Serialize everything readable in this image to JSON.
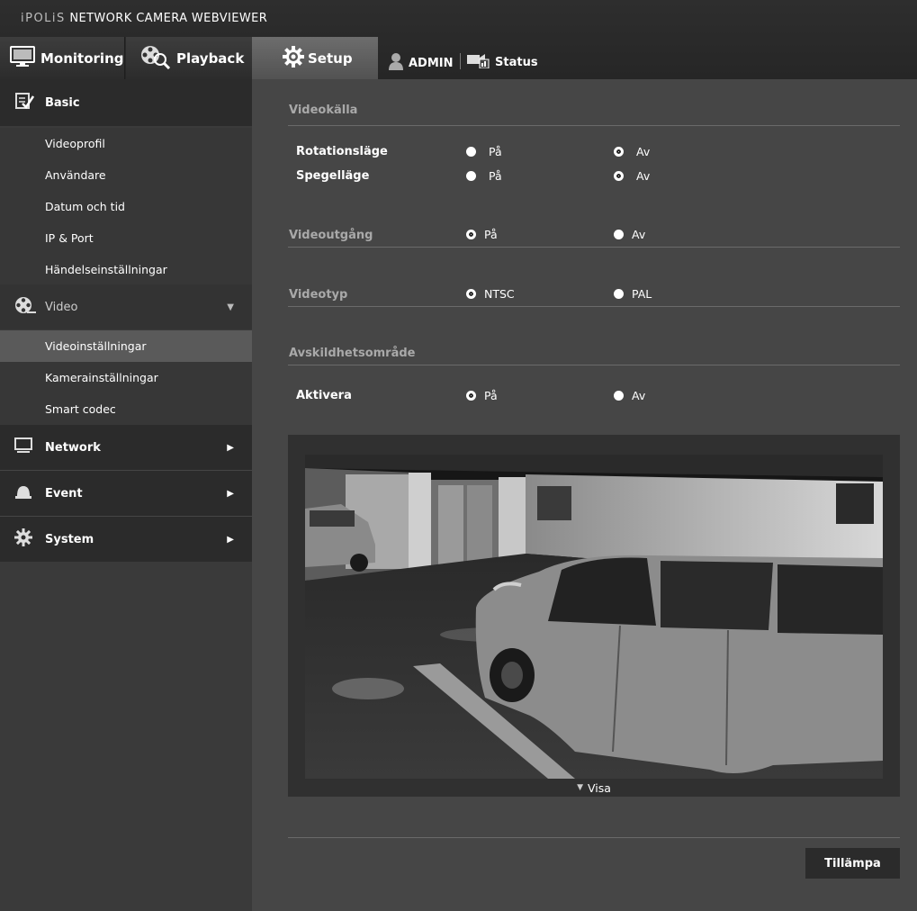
{
  "app": {
    "brand_prefix": "iPOLiS",
    "brand_title": "NETWORK CAMERA WEBVIEWER"
  },
  "nav": {
    "monitoring": "Monitoring",
    "playback": "Playback",
    "setup": "Setup",
    "admin": "ADMIN",
    "status": "Status"
  },
  "sidebar": {
    "basic": {
      "label": "Basic",
      "items": [
        "Videoprofil",
        "Användare",
        "Datum och tid",
        "IP & Port",
        "Händelseinställningar"
      ]
    },
    "video": {
      "label": "Video",
      "items": [
        "Videoinställningar",
        "Kamerainställningar",
        "Smart codec"
      ],
      "active_item": "Videoinställningar"
    },
    "network": {
      "label": "Network"
    },
    "event": {
      "label": "Event"
    },
    "system": {
      "label": "System"
    }
  },
  "main": {
    "videokalla": {
      "title": "Videokälla",
      "rotation": {
        "label": "Rotationsläge",
        "opt_on": "På",
        "opt_off": "Av",
        "selected": "Av"
      },
      "mirror": {
        "label": "Spegelläge",
        "opt_on": "På",
        "opt_off": "Av",
        "selected": "Av"
      }
    },
    "videoutgang": {
      "title": "Videoutgång",
      "opt_on": "På",
      "opt_off": "Av",
      "selected": "På"
    },
    "videotyp": {
      "title": "Videotyp",
      "opt_ntsc": "NTSC",
      "opt_pal": "PAL",
      "selected": "NTSC"
    },
    "privacy": {
      "title": "Avskildhetsområde",
      "enable": {
        "label": "Aktivera",
        "opt_on": "På",
        "opt_off": "Av",
        "selected": "På"
      }
    },
    "preview": {
      "toggle_label": "Visa"
    },
    "apply_label": "Tillämpa"
  }
}
